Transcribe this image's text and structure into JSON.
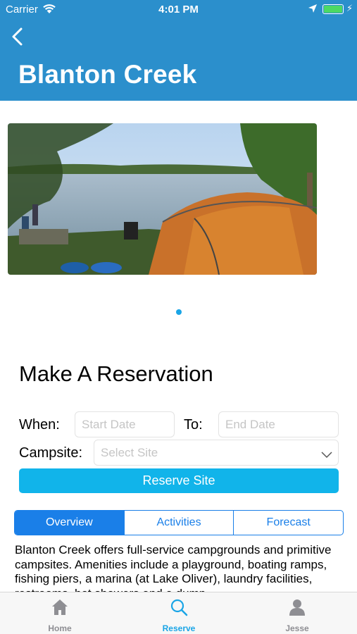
{
  "status_bar": {
    "carrier": "Carrier",
    "time": "4:01 PM"
  },
  "nav": {
    "title": "Blanton Creek"
  },
  "gallery": {
    "pages": 1,
    "current_page": 1
  },
  "reservation": {
    "heading": "Make A Reservation",
    "when_label": "When:",
    "start_placeholder": "Start Date",
    "to_label": "To:",
    "end_placeholder": "End Date",
    "campsite_label": "Campsite:",
    "site_placeholder": "Select Site",
    "reserve_button": "Reserve Site"
  },
  "segments": [
    {
      "label": "Overview",
      "selected": true
    },
    {
      "label": "Activities",
      "selected": false
    },
    {
      "label": "Forecast",
      "selected": false
    }
  ],
  "overview_text": "Blanton Creek offers full-service campgrounds and primitive campsites. Amenities include a playground, boating ramps, fishing piers, a marina (at Lake Oliver), laundry facilities, restrooms, hot showers and a dump",
  "tabbar": [
    {
      "label": "Home",
      "icon": "home-icon",
      "active": false
    },
    {
      "label": "Reserve",
      "icon": "search-icon",
      "active": true
    },
    {
      "label": "Jesse",
      "icon": "user-icon",
      "active": false
    }
  ],
  "colors": {
    "nav_bar": "#2b8fcc",
    "button": "#11b4ea",
    "segment": "#1a7fe8",
    "active_tab": "#1aa5e6"
  }
}
